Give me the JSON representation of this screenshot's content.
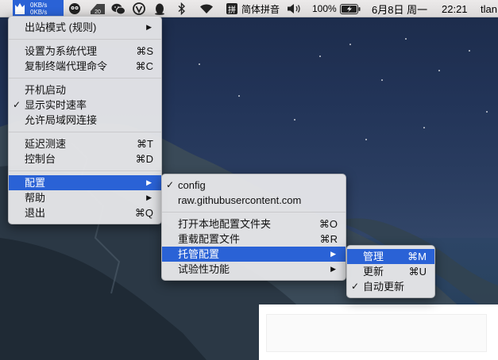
{
  "menubar": {
    "speed_up": "0KB/s",
    "speed_down": "0KB/s",
    "battery_badge": "20",
    "ime_glyph": "拼",
    "ime_label": "简体拼音",
    "battery_percent": "100%",
    "date": "6月8日 周一",
    "time": "22:21",
    "user": "tlan",
    "icons": [
      "clash-tray-icon",
      "owl-icon",
      "calendar-badge-icon",
      "wechat-icon",
      "v-app-icon",
      "qq-penguin-icon",
      "bluetooth-icon",
      "wifi-icon",
      "volume-icon",
      "battery-icon"
    ]
  },
  "main_menu": {
    "outbound_mode": "出站模式 (规则)",
    "set_system_proxy": "设置为系统代理",
    "set_system_proxy_shortcut": "⌘S",
    "copy_terminal_cmd": "复制终端代理命令",
    "copy_terminal_cmd_shortcut": "⌘C",
    "launch_at_login": "开机启动",
    "show_speed": "显示实时速率",
    "allow_lan": "允许局域网连接",
    "latency_test": "延迟测速",
    "latency_test_shortcut": "⌘T",
    "dashboard": "控制台",
    "dashboard_shortcut": "⌘D",
    "config": "配置",
    "help": "帮助",
    "quit": "退出",
    "quit_shortcut": "⌘Q",
    "checkmark": "✓",
    "submenu_arrow": "▶"
  },
  "config_menu": {
    "config_name": "config",
    "remote_host": "raw.githubusercontent.com",
    "open_folder": "打开本地配置文件夹",
    "open_folder_shortcut": "⌘O",
    "reload": "重载配置文件",
    "reload_shortcut": "⌘R",
    "managed": "托管配置",
    "experimental": "试验性功能"
  },
  "managed_menu": {
    "manage": "管理",
    "manage_shortcut": "⌘M",
    "update": "更新",
    "update_shortcut": "⌘U",
    "auto_update": "自动更新"
  },
  "colors": {
    "selection": "#2a62d6",
    "menubar": "#e4e2e2"
  }
}
